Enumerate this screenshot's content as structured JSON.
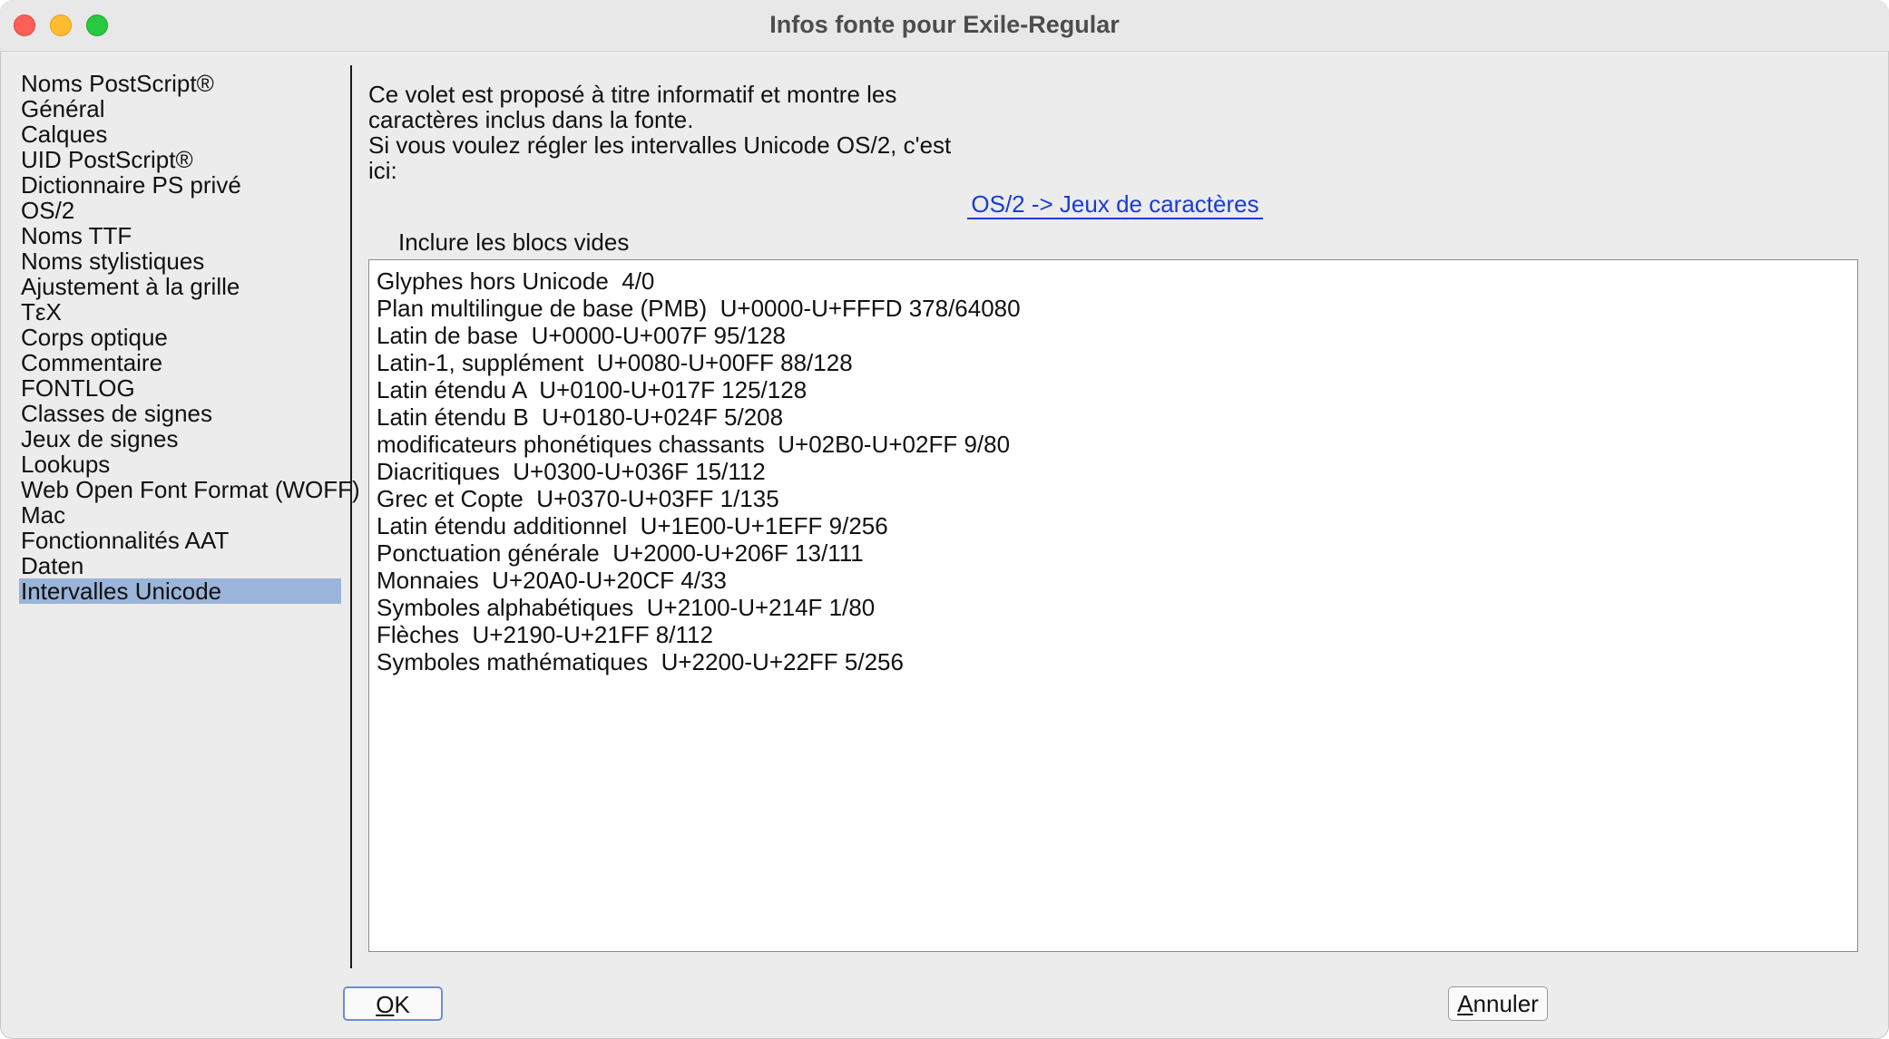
{
  "window": {
    "title": "Infos fonte pour Exile-Regular"
  },
  "sidebar": {
    "items": [
      {
        "label": "Noms PostScript®"
      },
      {
        "label": "Général"
      },
      {
        "label": "Calques"
      },
      {
        "label": "UID PostScript®"
      },
      {
        "label": "Dictionnaire PS privé"
      },
      {
        "label": "OS/2"
      },
      {
        "label": "Noms TTF"
      },
      {
        "label": "Noms stylistiques"
      },
      {
        "label": "Ajustement à la grille"
      },
      {
        "label": "TεX"
      },
      {
        "label": "Corps optique"
      },
      {
        "label": "Commentaire"
      },
      {
        "label": "FONTLOG"
      },
      {
        "label": "Classes de signes"
      },
      {
        "label": "Jeux de signes"
      },
      {
        "label": "Lookups"
      },
      {
        "label": "Web Open Font Format (WOFF)"
      },
      {
        "label": "Mac"
      },
      {
        "label": "Fonctionnalités AAT"
      },
      {
        "label": "Daten"
      },
      {
        "label": "Intervalles Unicode",
        "selected": true
      }
    ]
  },
  "main": {
    "info_lines": [
      "Ce volet est proposé à titre informatif et montre les",
      "caractères inclus dans la fonte.",
      "Si vous voulez régler les intervalles Unicode OS/2, c'est",
      "ici:"
    ],
    "link_label": "OS/2 -> Jeux de caractères",
    "include_empty_label": "Inclure les blocs vides",
    "ranges": [
      "Glyphes hors Unicode  4/0",
      "Plan multilingue de base (PMB)  U+0000-U+FFFD 378/64080",
      "Latin de base  U+0000-U+007F 95/128",
      "Latin-1, supplément  U+0080-U+00FF 88/128",
      "Latin étendu A  U+0100-U+017F 125/128",
      "Latin étendu B  U+0180-U+024F 5/208",
      "modificateurs phonétiques chassants  U+02B0-U+02FF 9/80",
      "Diacritiques  U+0300-U+036F 15/112",
      "Grec et Copte  U+0370-U+03FF 1/135",
      "Latin étendu additionnel  U+1E00-U+1EFF 9/256",
      "Ponctuation générale  U+2000-U+206F 13/111",
      "Monnaies  U+20A0-U+20CF 4/33",
      "Symboles alphabétiques  U+2100-U+214F 1/80",
      "Flèches  U+2190-U+21FF 8/112",
      "Symboles mathématiques  U+2200-U+22FF 5/256"
    ]
  },
  "buttons": {
    "ok_mnemonic": "O",
    "ok_rest": "K",
    "cancel_mnemonic": "A",
    "cancel_rest": "nnuler"
  },
  "colors": {
    "selection": "#9bb4d9",
    "link": "#1a3cd4",
    "close": "#fe5f57",
    "minimize": "#febc2e",
    "maximize": "#28c840"
  }
}
